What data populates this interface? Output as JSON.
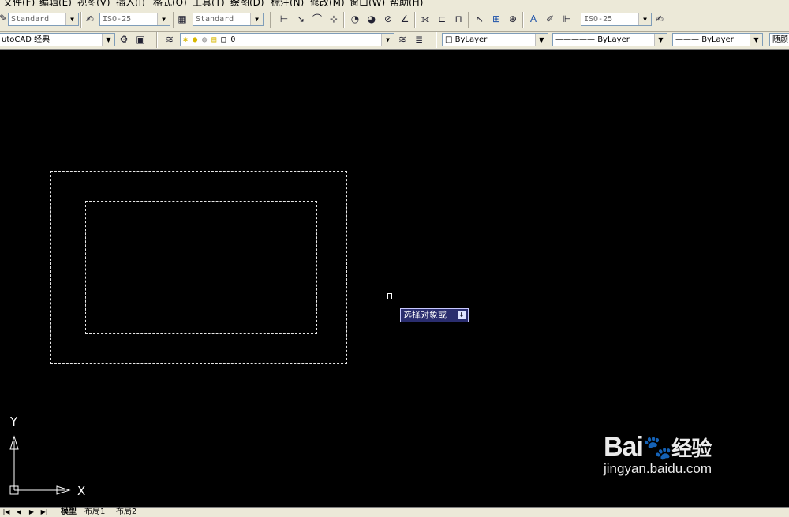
{
  "menu": {
    "items": [
      "文件(F)",
      "编辑(E)",
      "视图(V)",
      "插入(I)",
      "格式(O)",
      "工具(T)",
      "绘图(D)",
      "标注(N)",
      "修改(M)",
      "窗口(W)",
      "帮助(H)"
    ]
  },
  "toolbar": {
    "text_style": "Standard",
    "dim_style": "ISO-25",
    "table_style": "Standard",
    "multileader_style": "ISO-25",
    "workspace": "utoCAD 经典",
    "layer": "0",
    "color": "ByLayer",
    "linetype": "ByLayer",
    "lineweight": "ByLayer",
    "plot_style": "随颜"
  },
  "drawing": {
    "prompt_tooltip": "选择对象或",
    "ucs_x": "X",
    "ucs_y": "Y"
  },
  "watermark": {
    "logo": "Bai",
    "logo_suffix": "经验",
    "url": "jingyan.baidu.com"
  },
  "layout_tabs": [
    "模型",
    "布局1",
    "布局2"
  ],
  "colors": {
    "canvas": "#000000",
    "toolbar": "#ece9d8",
    "tooltip_bg": "#2a2d6e"
  }
}
